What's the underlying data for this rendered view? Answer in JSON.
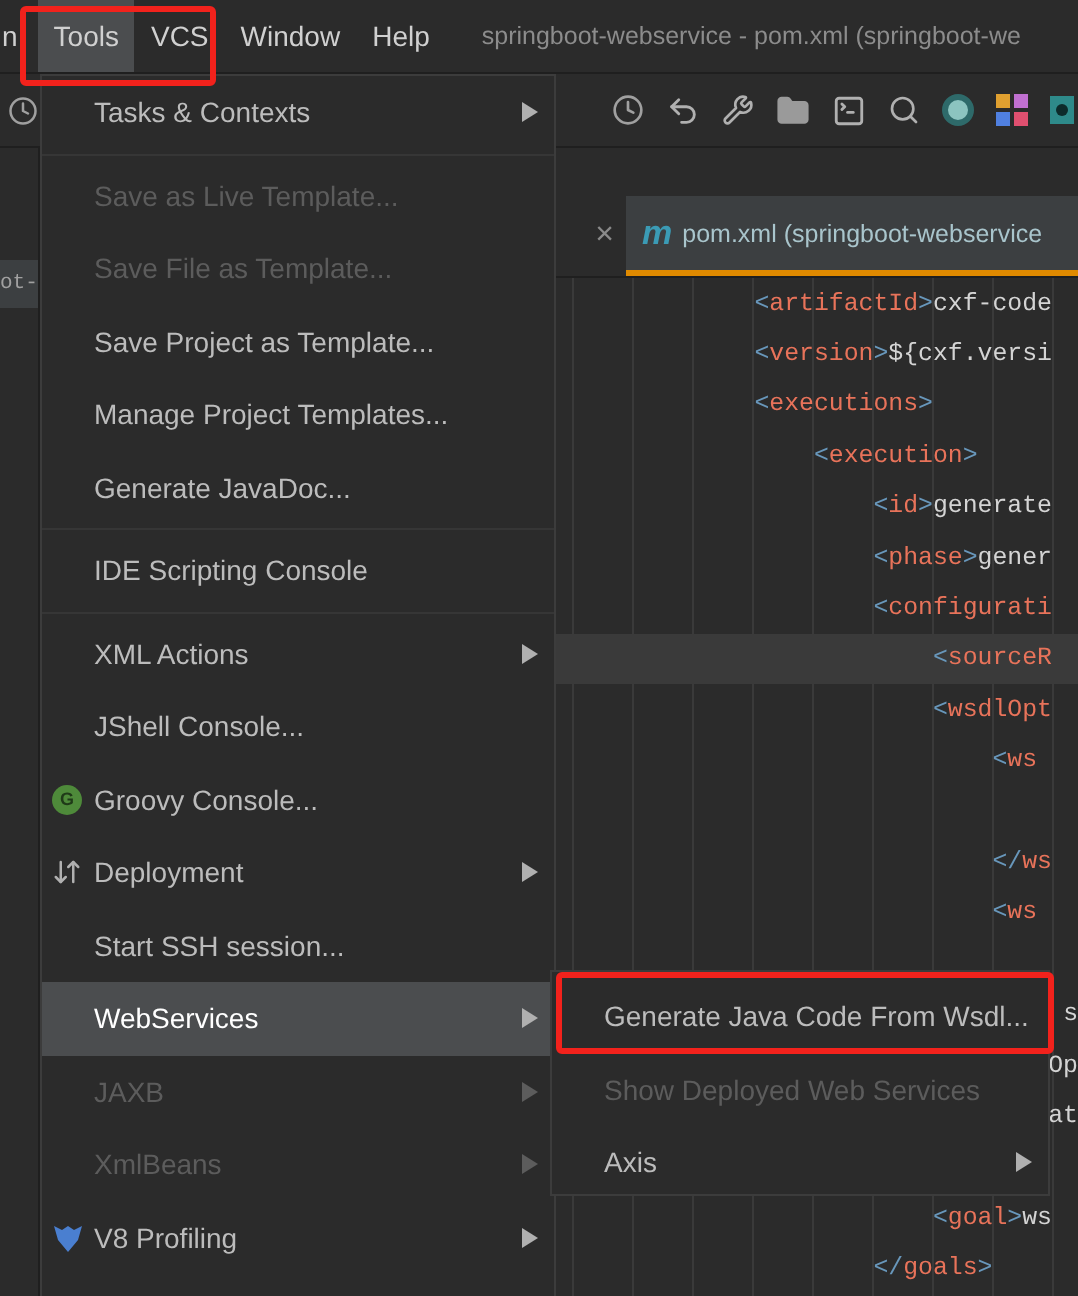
{
  "menu_bar": {
    "items": [
      {
        "label": "n",
        "selected": false
      },
      {
        "label": "Tools",
        "selected": true
      },
      {
        "label": "VCS",
        "selected": false
      },
      {
        "label": "Window",
        "selected": false
      },
      {
        "label": "Help",
        "selected": false
      }
    ],
    "title": "springboot-webservice - pom.xml (springboot-we"
  },
  "left_panel": {
    "label": "ot-"
  },
  "editor": {
    "closed_tab": {
      "close": "×"
    },
    "active_tab": {
      "icon_text": "m",
      "label": "pom.xml (springboot-webservice",
      "selected": true
    },
    "lines": [
      {
        "kind": "code",
        "text": "            <artifactId>cxf-code",
        "current": false
      },
      {
        "kind": "code",
        "text": "            <version>${cxf.versi",
        "current": false
      },
      {
        "kind": "code",
        "text": "            <executions>",
        "current": false
      },
      {
        "kind": "code",
        "text": "                <execution>",
        "current": false
      },
      {
        "kind": "code",
        "text": "                    <id>generate",
        "current": false
      },
      {
        "kind": "code",
        "text": "                    <phase>gener",
        "current": false
      },
      {
        "kind": "code",
        "text": "                    <configurati",
        "current": false
      },
      {
        "kind": "code",
        "text": "                        <sourceR",
        "current": true
      },
      {
        "kind": "code",
        "text": "                        <wsdlOpt",
        "current": false
      },
      {
        "kind": "code",
        "text": "                            <ws",
        "current": false
      },
      {
        "kind": "code",
        "current": false
      },
      {
        "kind": "code",
        "text": "                            </ws",
        "current": false
      },
      {
        "kind": "code",
        "text": "                            <ws",
        "current": false
      },
      {
        "kind": "code",
        "current": false
      },
      {
        "kind": "fragment",
        "text": "s",
        "current": false
      },
      {
        "kind": "fragment",
        "text": "Op",
        "current": false
      },
      {
        "kind": "fragment",
        "text": "at",
        "current": false
      },
      {
        "kind": "code",
        "current": false
      },
      {
        "kind": "code",
        "text": "                        <goal>ws",
        "current": false
      },
      {
        "kind": "code",
        "text": "                    </goals>",
        "current": false
      }
    ]
  },
  "tools_menu": {
    "items": [
      {
        "kind": "submenu",
        "label": "Tasks & Contexts",
        "disabled": false,
        "selected": false
      },
      {
        "kind": "separator"
      },
      {
        "kind": "action",
        "label": "Save as Live Template...",
        "disabled": true,
        "selected": false
      },
      {
        "kind": "action",
        "label": "Save File as Template...",
        "disabled": true,
        "selected": false
      },
      {
        "kind": "action",
        "label": "Save Project as Template...",
        "disabled": false,
        "selected": false
      },
      {
        "kind": "action",
        "label": "Manage Project Templates...",
        "disabled": false,
        "selected": false
      },
      {
        "kind": "action",
        "label": "Generate JavaDoc...",
        "disabled": false,
        "selected": false
      },
      {
        "kind": "separator"
      },
      {
        "kind": "action",
        "label": "IDE Scripting Console",
        "disabled": false,
        "selected": false
      },
      {
        "kind": "separator"
      },
      {
        "kind": "submenu",
        "label": "XML Actions",
        "disabled": false,
        "selected": false
      },
      {
        "kind": "action",
        "label": "JShell Console...",
        "disabled": false,
        "selected": false
      },
      {
        "kind": "action",
        "label": "Groovy Console...",
        "disabled": false,
        "selected": false,
        "badge": "G"
      },
      {
        "kind": "submenu",
        "label": "Deployment",
        "disabled": false,
        "selected": false
      },
      {
        "kind": "action",
        "label": "Start SSH session...",
        "disabled": false,
        "selected": false
      },
      {
        "kind": "submenu",
        "label": "WebServices",
        "disabled": false,
        "selected": true
      },
      {
        "kind": "submenu",
        "label": "JAXB",
        "disabled": true,
        "selected": false
      },
      {
        "kind": "submenu",
        "label": "XmlBeans",
        "disabled": true,
        "selected": false
      },
      {
        "kind": "submenu",
        "label": "V8 Profiling",
        "disabled": false,
        "selected": false
      }
    ]
  },
  "webservices_submenu": {
    "items": [
      {
        "kind": "action",
        "label": "Generate Java Code From Wsdl...",
        "disabled": false,
        "selected": false,
        "highlighted": true
      },
      {
        "kind": "action",
        "label": "Show Deployed Web Services",
        "disabled": true,
        "selected": false,
        "highlighted": false
      },
      {
        "kind": "submenu",
        "label": "Axis",
        "disabled": false,
        "selected": false,
        "highlighted": false
      }
    ]
  }
}
